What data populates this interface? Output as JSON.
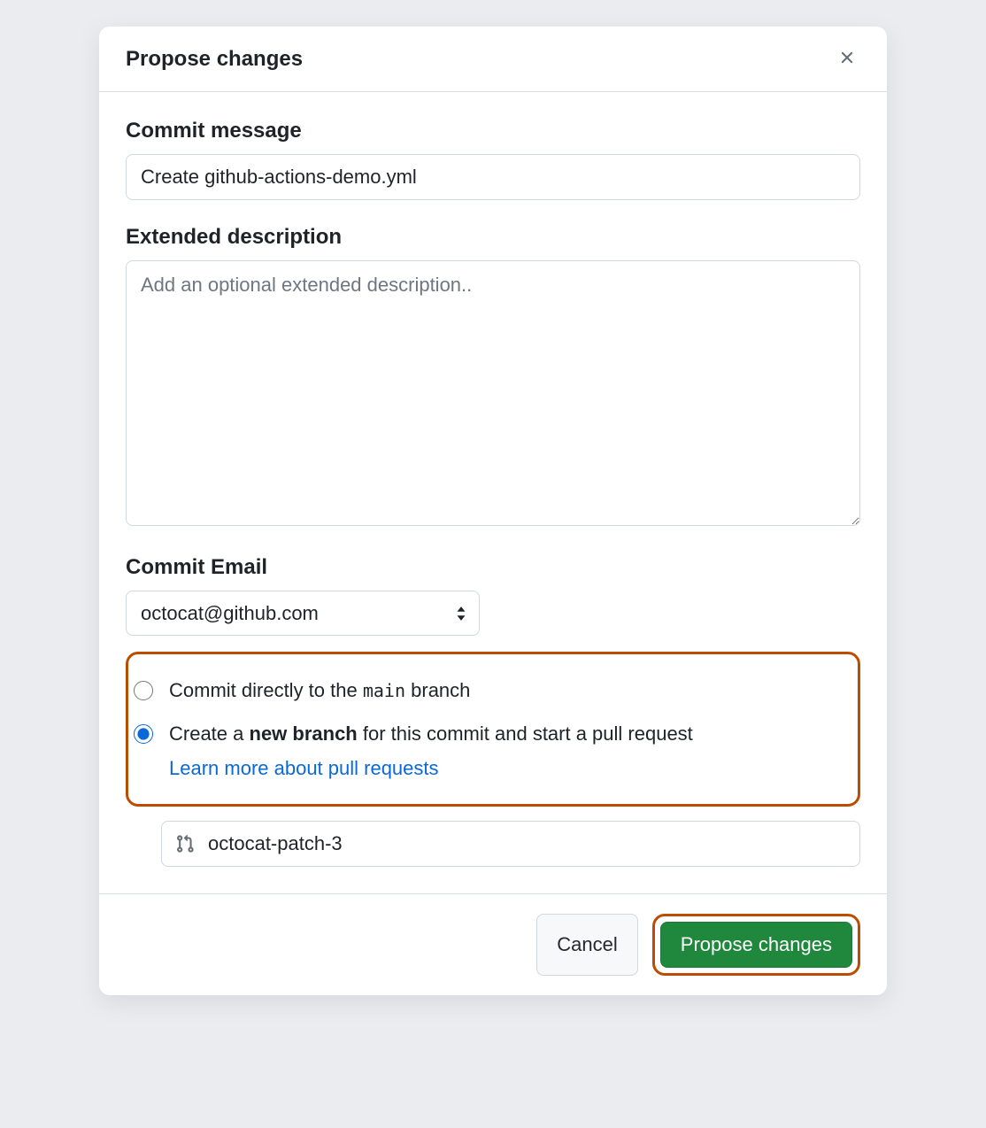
{
  "dialog": {
    "title": "Propose changes"
  },
  "commit_message": {
    "label": "Commit message",
    "value": "Create github-actions-demo.yml"
  },
  "extended_description": {
    "label": "Extended description",
    "placeholder": "Add an optional extended description.."
  },
  "commit_email": {
    "label": "Commit Email",
    "value": "octocat@github.com"
  },
  "branch_options": {
    "direct_prefix": "Commit directly to the ",
    "direct_branch": "main",
    "direct_suffix": " branch",
    "new_prefix": "Create a ",
    "new_bold": "new branch",
    "new_suffix": " for this commit and start a pull request",
    "learn_more": "Learn more about pull requests"
  },
  "branch_name": {
    "value": "octocat-patch-3"
  },
  "footer": {
    "cancel": "Cancel",
    "propose": "Propose changes"
  }
}
